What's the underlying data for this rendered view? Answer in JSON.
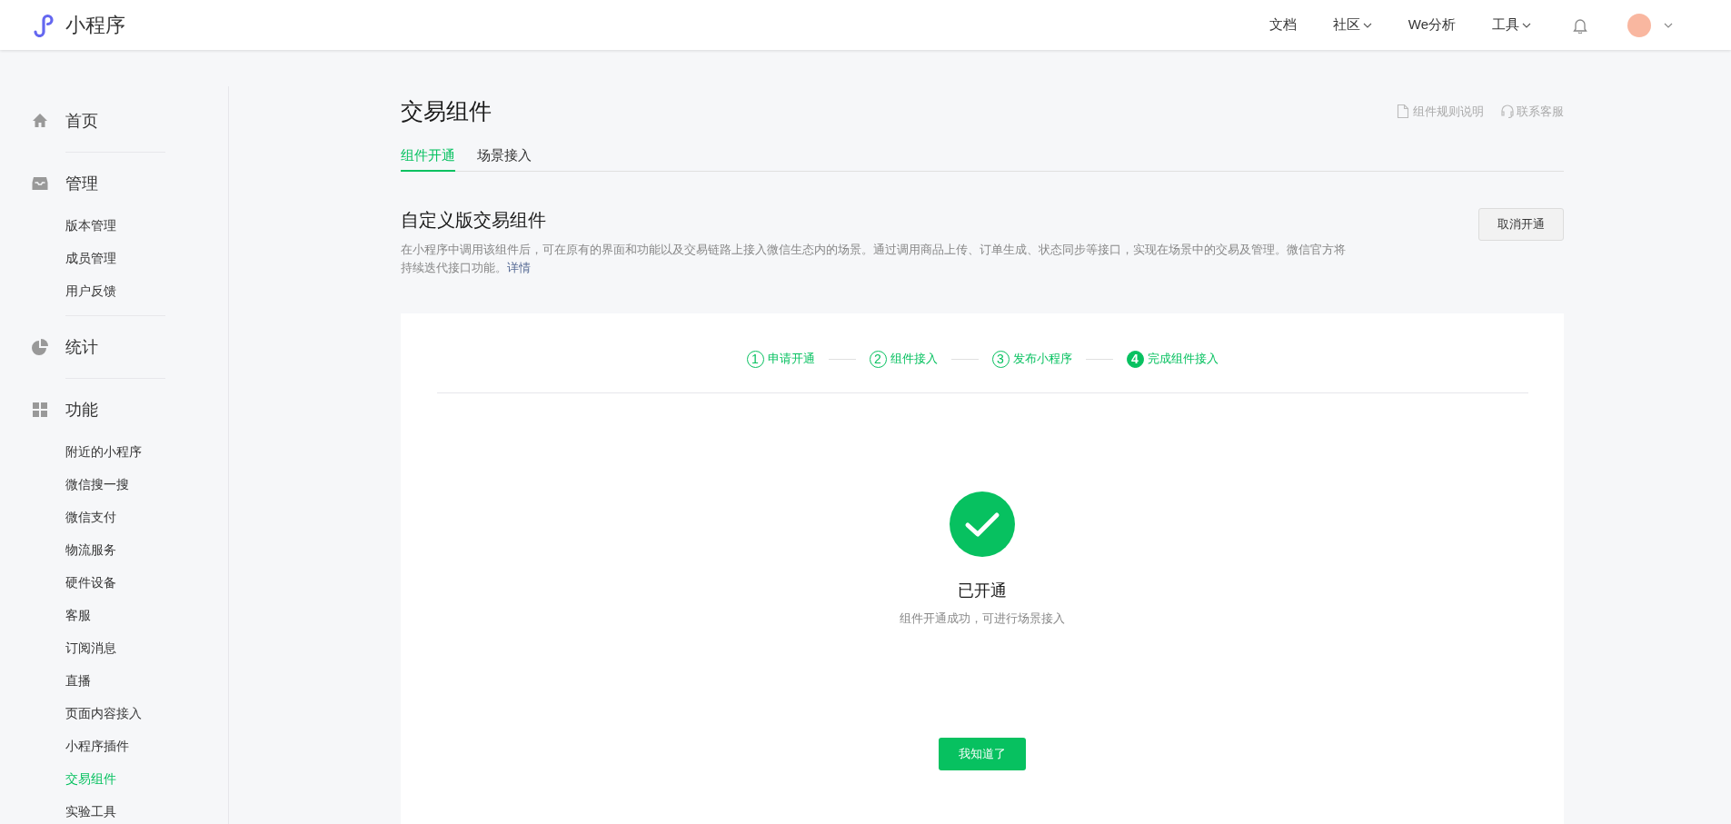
{
  "topbar": {
    "brand": "小程序",
    "nav": [
      {
        "label": "文档",
        "dropdown": false
      },
      {
        "label": "社区",
        "dropdown": true
      },
      {
        "label": "We分析",
        "dropdown": false
      },
      {
        "label": "工具",
        "dropdown": true
      }
    ]
  },
  "sidebar": {
    "groups": [
      {
        "kind": "home",
        "label": "首页"
      },
      {
        "kind": "manage",
        "label": "管理",
        "items": [
          {
            "label": "版本管理",
            "selected": false
          },
          {
            "label": "成员管理",
            "selected": false
          },
          {
            "label": "用户反馈",
            "selected": false
          }
        ]
      },
      {
        "kind": "stats",
        "label": "统计"
      },
      {
        "kind": "features",
        "label": "功能",
        "items": [
          {
            "label": "附近的小程序",
            "selected": false
          },
          {
            "label": "微信搜一搜",
            "selected": false
          },
          {
            "label": "微信支付",
            "selected": false
          },
          {
            "label": "物流服务",
            "selected": false
          },
          {
            "label": "硬件设备",
            "selected": false
          },
          {
            "label": "客服",
            "selected": false
          },
          {
            "label": "订阅消息",
            "selected": false
          },
          {
            "label": "直播",
            "selected": false
          },
          {
            "label": "页面内容接入",
            "selected": false
          },
          {
            "label": "小程序插件",
            "selected": false
          },
          {
            "label": "交易组件",
            "selected": true
          },
          {
            "label": "实验工具",
            "selected": false
          }
        ]
      }
    ]
  },
  "page": {
    "title": "交易组件",
    "links": [
      {
        "kind": "doc",
        "label": "组件规则说明"
      },
      {
        "kind": "support",
        "label": "联系客服"
      }
    ],
    "tabs": [
      {
        "label": "组件开通",
        "selected": true
      },
      {
        "label": "场景接入",
        "selected": false
      }
    ],
    "section": {
      "title": "自定义版交易组件",
      "description": "在小程序中调用该组件后，可在原有的界面和功能以及交易链路上接入微信生态内的场景。通过调用商品上传、订单生成、状态同步等接口，实现在场景中的交易及管理。微信官方将持续迭代接口功能。",
      "link": "详情",
      "button": "取消开通"
    },
    "steps": [
      {
        "number": "1",
        "label": "申请开通",
        "selected": false
      },
      {
        "number": "2",
        "label": "组件接入",
        "selected": false
      },
      {
        "number": "3",
        "label": "发布小程序",
        "selected": false
      },
      {
        "number": "4",
        "label": "完成组件接入",
        "selected": true
      }
    ],
    "result": {
      "title": "已开通",
      "message": "组件开通成功，可进行场景接入",
      "button": "我知道了"
    }
  }
}
